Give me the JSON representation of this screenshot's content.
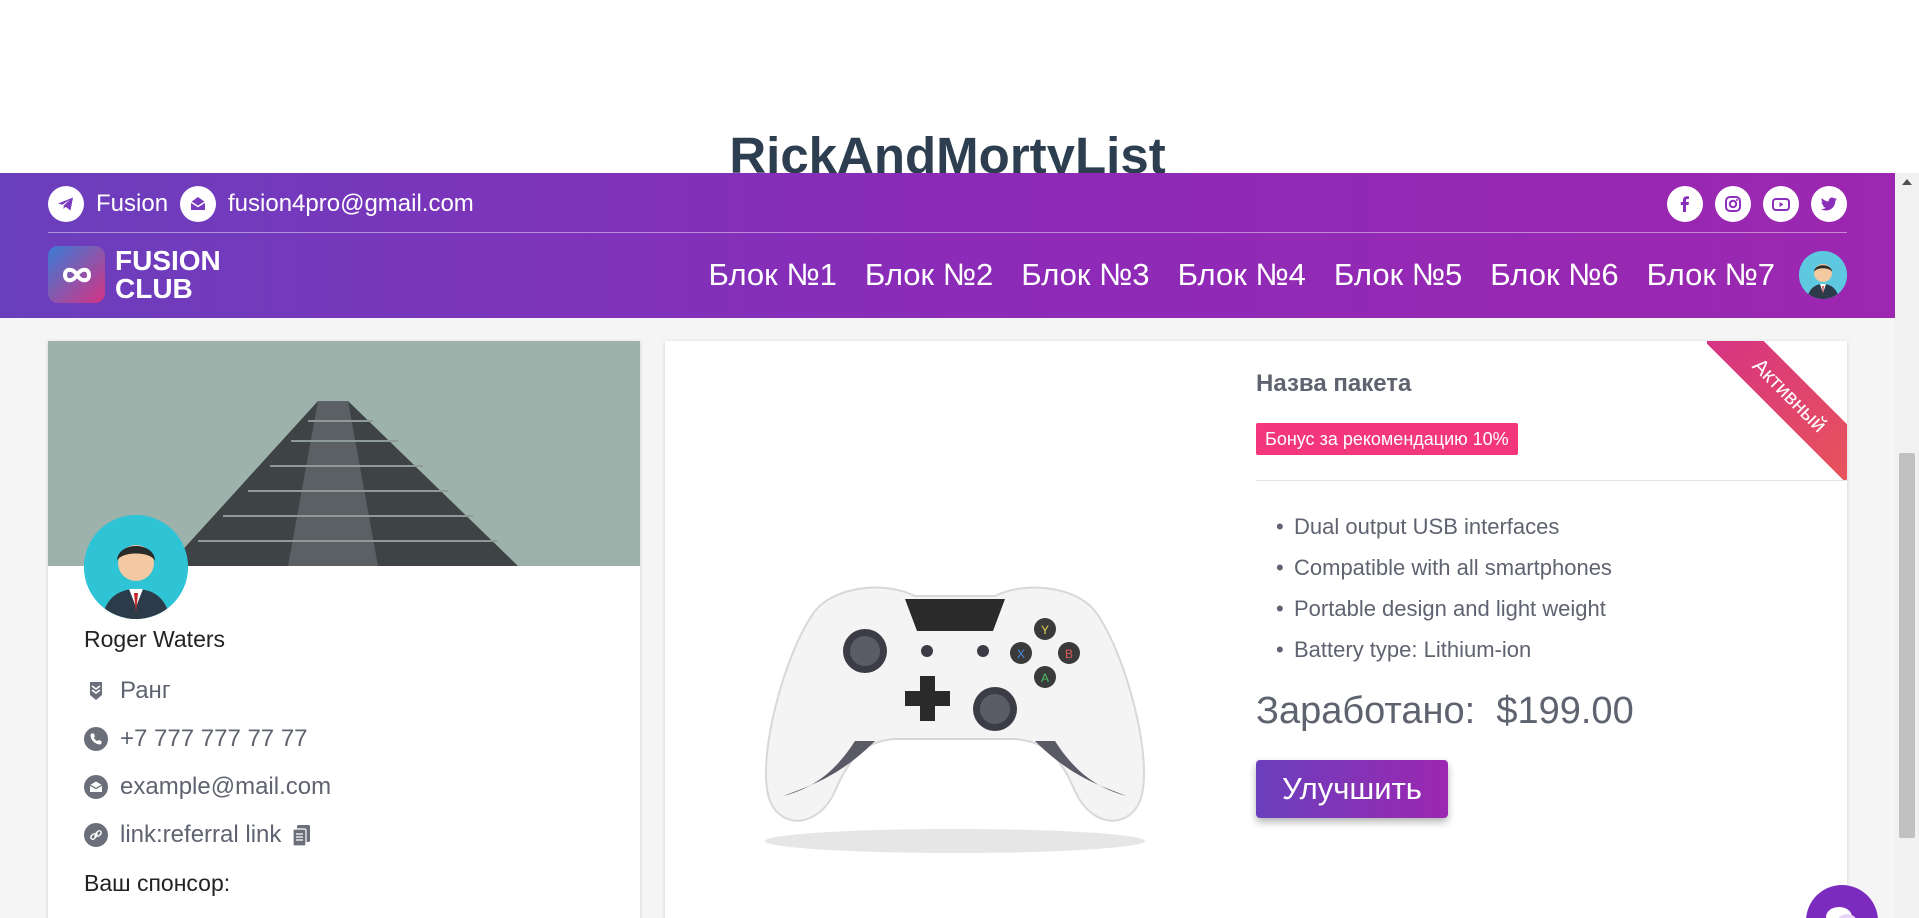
{
  "page": {
    "heading": "RickAndMortyList"
  },
  "topbar": {
    "telegram_label": "Fusion",
    "email": "fusion4pro@gmail.com",
    "socials": [
      "facebook-icon",
      "instagram-icon",
      "youtube-icon",
      "twitter-icon"
    ]
  },
  "brand": {
    "line1": "FUSION",
    "line2": "CLUB"
  },
  "nav": {
    "links": [
      "Блок №1",
      "Блок №2",
      "Блок №3",
      "Блок №4",
      "Блок №5",
      "Блок №6",
      "Блок №7"
    ]
  },
  "profile": {
    "name": "Roger Waters",
    "rank": "Ранг",
    "phone": "+7 777 777 77 77",
    "email": "example@mail.com",
    "referral": "link:referral link",
    "sponsor_label": "Ваш спонсор:"
  },
  "product": {
    "ribbon": "Активный",
    "title": "Назва пакета",
    "bonus": "Бонус за рекомендацию 10%",
    "features": [
      "Dual output USB interfaces",
      "Compatible with all smartphones",
      "Portable design and light weight",
      "Battery type: Lithium-ion"
    ],
    "earned_label": "Заработано:",
    "earned_value": "$199.00",
    "upgrade_label": "Улучшить"
  },
  "colors": {
    "nav_gradient_start": "#6a3fbd",
    "nav_gradient_end": "#9c27b0",
    "bonus_badge": "#f4367c",
    "ribbon": "#d63384"
  }
}
